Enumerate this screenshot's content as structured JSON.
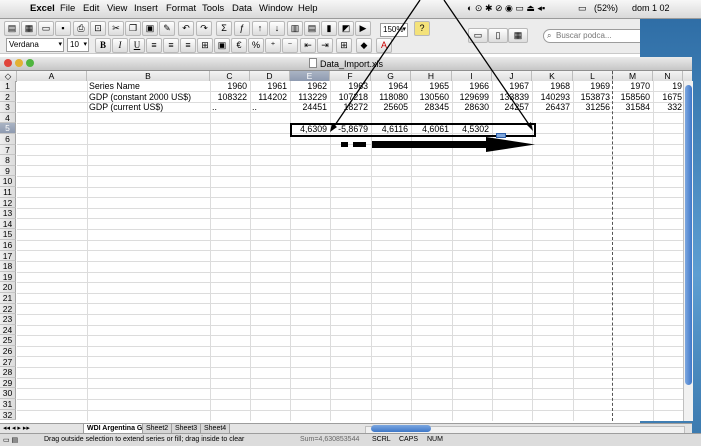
{
  "menubar": {
    "app": "Excel",
    "items": [
      "File",
      "Edit",
      "View",
      "Insert",
      "Format",
      "Tools",
      "Data",
      "Window",
      "Help"
    ],
    "battery": "(52%)",
    "clock": "dom 1 02"
  },
  "toolbar": {
    "font_name": "Verdana",
    "font_size": "10",
    "zoom": "150%",
    "search_placeholder": "Buscar podca..."
  },
  "window": {
    "title": "Data_Import.xls"
  },
  "columns": [
    "A",
    "B",
    "C",
    "D",
    "E",
    "F",
    "G",
    "H",
    "I",
    "J",
    "K",
    "L",
    "M",
    "N"
  ],
  "selected_column": "E",
  "rows": [
    "1",
    "2",
    "3",
    "4",
    "5",
    "6",
    "7",
    "8",
    "9",
    "10",
    "11",
    "12",
    "13",
    "14",
    "15",
    "16",
    "17",
    "18",
    "19",
    "20",
    "21",
    "22",
    "23",
    "24",
    "25",
    "26",
    "27",
    "28",
    "29",
    "30",
    "31",
    "32"
  ],
  "selected_row": "5",
  "cells": {
    "row1": [
      "Series Name",
      "1960",
      "1961",
      "1962",
      "1963",
      "1964",
      "1965",
      "1966",
      "1967",
      "1968",
      "1969",
      "1970",
      "19"
    ],
    "row2": [
      "GDP (constant 2000 US$)",
      "108322",
      "114202",
      "113229",
      "107218",
      "118080",
      "130560",
      "129699",
      "133839",
      "140293",
      "153873",
      "158560",
      "1675"
    ],
    "row3": [
      "GDP (current US$)",
      "..",
      "..",
      "24451",
      "18272",
      "25605",
      "28345",
      "28630",
      "24257",
      "26437",
      "31256",
      "31584",
      "332"
    ],
    "row5": [
      "4,6309",
      "-5,8679",
      "4,6116",
      "4,6061",
      "4,5302"
    ]
  },
  "sheet_tabs": [
    "WDI Argentina GDP",
    "Sheet2",
    "Sheet3",
    "Sheet4"
  ],
  "active_tab": "WDI Argentina GDP",
  "status": {
    "message": "Drag outside selection to extend series or fill; drag inside to clear",
    "sum": "Sum=4,630853544",
    "scrl": "SCRL",
    "caps": "CAPS",
    "num": "NUM"
  }
}
